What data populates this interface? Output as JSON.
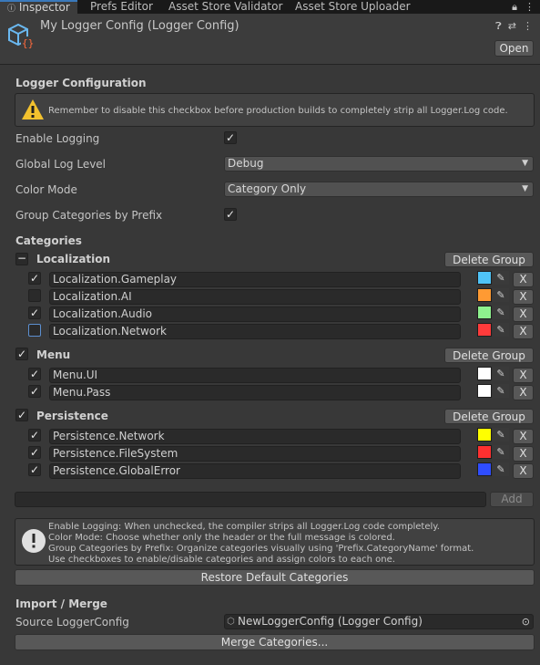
{
  "tabs": [
    "Inspector",
    "Prefs Editor",
    "Asset Store Validator",
    "Asset Store Uploader"
  ],
  "header": {
    "title": "My Logger Config (Logger Config)",
    "open_label": "Open"
  },
  "section_title": "Logger Configuration",
  "warning": "Remember to disable this checkbox before production builds to completely strip all Logger.Log code.",
  "settings": {
    "enable_logging_label": "Enable Logging",
    "global_level_label": "Global Log Level",
    "global_level_value": "Debug",
    "color_mode_label": "Color Mode",
    "color_mode_value": "Category Only",
    "group_prefix_label": "Group Categories by Prefix"
  },
  "categories_title": "Categories",
  "delete_group_label": "Delete Group",
  "x_label": "X",
  "groups": [
    {
      "name": "Localization",
      "items": [
        {
          "name": "Localization.Gameplay",
          "enabled": true,
          "color": "#4fc3f7"
        },
        {
          "name": "Localization.AI",
          "enabled": false,
          "color": "#ff9a33"
        },
        {
          "name": "Localization.Audio",
          "enabled": true,
          "color": "#8ef28e"
        },
        {
          "name": "Localization.Network",
          "enabled": false,
          "color": "#ff3b3b"
        }
      ]
    },
    {
      "name": "Menu",
      "items": [
        {
          "name": "Menu.UI",
          "enabled": true,
          "color": "#ffffff"
        },
        {
          "name": "Menu.Pass",
          "enabled": true,
          "color": "#ffffff"
        }
      ]
    },
    {
      "name": "Persistence",
      "items": [
        {
          "name": "Persistence.Network",
          "enabled": true,
          "color": "#ffff00"
        },
        {
          "name": "Persistence.FileSystem",
          "enabled": true,
          "color": "#ff3030"
        },
        {
          "name": "Persistence.GlobalError",
          "enabled": true,
          "color": "#2f4dff"
        }
      ]
    }
  ],
  "add_label": "Add",
  "info": [
    "Enable Logging: When unchecked, the compiler strips all Logger.Log code completely.",
    "Color Mode: Choose whether only the header or the full message is colored.",
    "Group Categories by Prefix: Organize categories visually using 'Prefix.CategoryName' format.",
    "Use checkboxes to enable/disable categories and assign colors to each one."
  ],
  "restore_label": "Restore Default Categories",
  "import_title": "Import / Merge",
  "source_label": "Source LoggerConfig",
  "source_value": "NewLoggerConfig (Logger Config)",
  "merge_label": "Merge Categories..."
}
